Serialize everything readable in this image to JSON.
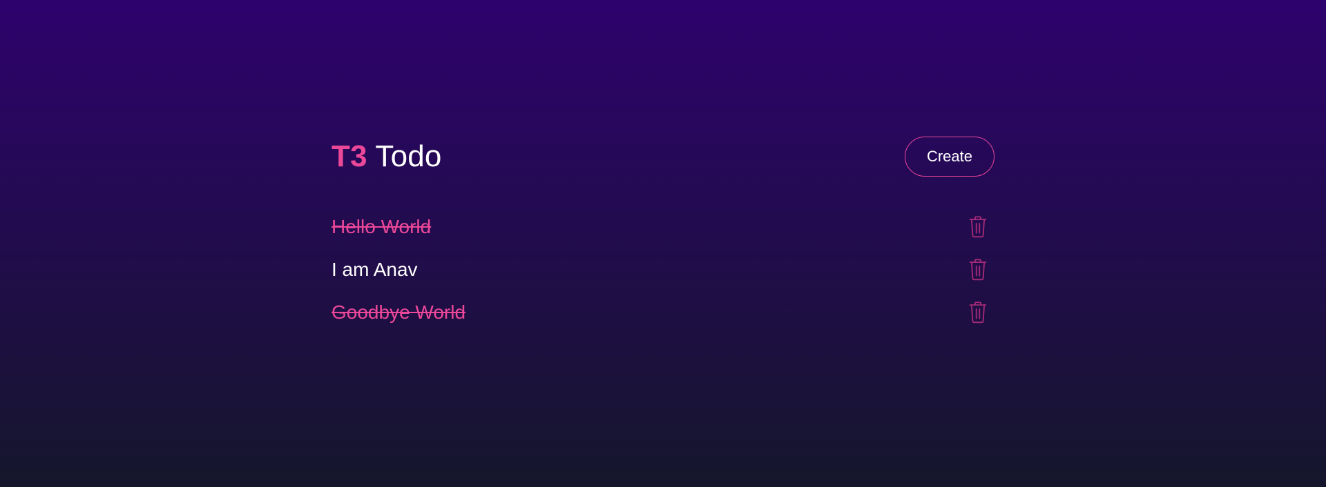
{
  "header": {
    "brand": "T3",
    "title": "Todo",
    "create_label": "Create"
  },
  "todos": [
    {
      "text": "Hello World",
      "completed": true
    },
    {
      "text": "I am Anav",
      "completed": false
    },
    {
      "text": "Goodbye World",
      "completed": true
    }
  ],
  "icons": {
    "delete": "trash-icon"
  },
  "colors": {
    "accent": "#ec4899",
    "icon": "#a62a78",
    "bg_top": "#2e026d",
    "bg_bottom": "#15162c",
    "text": "#ffffff"
  }
}
